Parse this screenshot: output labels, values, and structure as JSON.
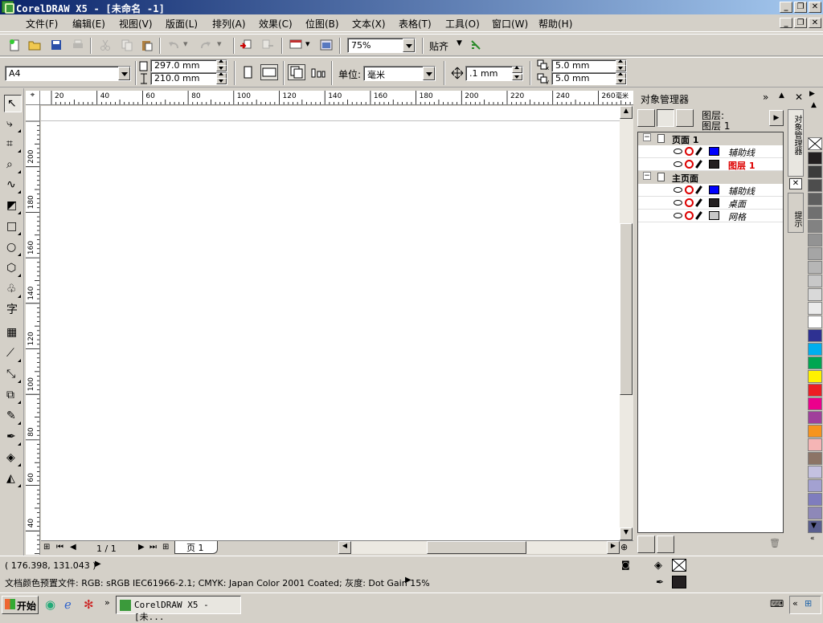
{
  "window": {
    "title": "CorelDRAW X5 - [未命名 -1]"
  },
  "menu": [
    "文件(F)",
    "编辑(E)",
    "视图(V)",
    "版面(L)",
    "排列(A)",
    "效果(C)",
    "位图(B)",
    "文本(X)",
    "表格(T)",
    "工具(O)",
    "窗口(W)",
    "帮助(H)"
  ],
  "std_toolbar": {
    "zoom": "75%",
    "snap_label": "贴齐"
  },
  "props": {
    "paper": "A4",
    "width": "297.0 mm",
    "height": "210.0 mm",
    "unit_label": "单位:",
    "unit": "毫米",
    "nudge": ".1 mm",
    "dup_x": "5.0 mm",
    "dup_y": "5.0 mm"
  },
  "ruler": {
    "h_ticks": [
      "20",
      "40",
      "60",
      "80",
      "100",
      "120",
      "140",
      "160",
      "180",
      "200",
      "220",
      "240",
      "260"
    ],
    "v_ticks": [
      "200",
      "180",
      "160",
      "140",
      "120",
      "100",
      "80",
      "60",
      "40"
    ],
    "h_unit": "毫米"
  },
  "page_nav": {
    "count": "1 / 1",
    "tab": "页 1"
  },
  "docker": {
    "title": "对象管理器",
    "layer_label": "图层:",
    "layer_value": "图层 1",
    "side_tab_1": "对象管理器",
    "side_tab_2": "提示",
    "tree": [
      {
        "type": "group",
        "label": "页面 1"
      },
      {
        "type": "layer",
        "label": "辅助线",
        "color": "#0000ff"
      },
      {
        "type": "layer",
        "label": "图层 1",
        "color": "#231f20",
        "active": true
      },
      {
        "type": "group",
        "label": "主页面"
      },
      {
        "type": "layer",
        "label": "辅助线",
        "color": "#0000ff"
      },
      {
        "type": "layer",
        "label": "桌面",
        "color": "#231f20"
      },
      {
        "type": "layer",
        "label": "网格",
        "color": "#c8c8c8"
      }
    ]
  },
  "palette": [
    "#231f20",
    "#3c3c3c",
    "#4d4d4d",
    "#5f5f5f",
    "#707070",
    "#828282",
    "#939393",
    "#a5a5a5",
    "#b6b6b6",
    "#c8c8c8",
    "#d9d9d9",
    "#ebebeb",
    "#ffffff",
    "#2e3192",
    "#00aeef",
    "#00a651",
    "#fff200",
    "#ed1c24",
    "#ec008c",
    "#a03f9b",
    "#f7941d",
    "#f5b5b5",
    "#8c7466",
    "#c4c1e0",
    "#a3a1d1",
    "#7f7dbe",
    "#8e88b8",
    "#5a5f8f"
  ],
  "status": {
    "coords": "( 176.398, 131.043 )",
    "color_profile": "文档颜色预置文件: RGB: sRGB IEC61966-2.1; CMYK: Japan Color 2001 Coated; 灰度: Dot Gain 15%"
  },
  "taskbar": {
    "start": "开始",
    "task": "CorelDRAW X5 - [未..."
  }
}
